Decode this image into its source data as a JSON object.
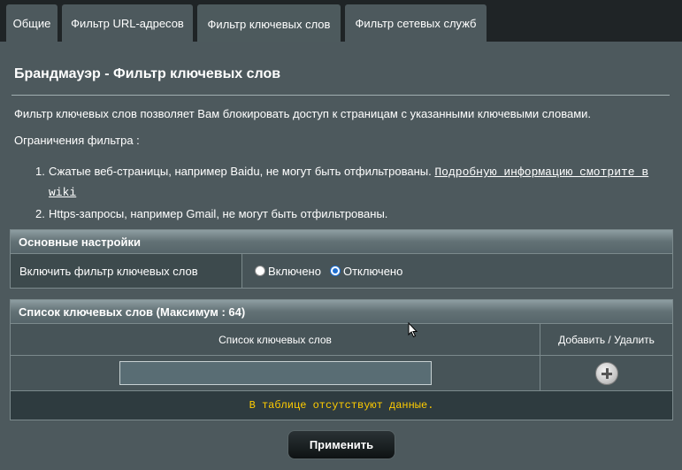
{
  "tabs": [
    {
      "label": "Общие"
    },
    {
      "label": "Фильтр URL-адресов"
    },
    {
      "label": "Фильтр ключевых слов"
    },
    {
      "label": "Фильтр сетевых служб"
    }
  ],
  "page": {
    "title": "Брандмауэр - Фильтр ключевых слов",
    "description": "Фильтр ключевых слов позволяет Вам блокировать доступ к страницам с указанными ключевыми словами.",
    "limits_label": "Ограничения фильтра :",
    "limits": [
      {
        "num": "1.",
        "text": "Сжатые веб-страницы, например Baidu, не могут быть отфильтрованы.",
        "link": "Подробную информацию смотрите в wiki"
      },
      {
        "num": "2.",
        "text": "Https-запросы, например Gmail, не могут быть отфильтрованы."
      }
    ]
  },
  "settings": {
    "header": "Основные настройки",
    "enable_label": "Включить фильтр ключевых слов",
    "options": [
      {
        "label": "Включено",
        "checked": false
      },
      {
        "label": "Отключено",
        "checked": true
      }
    ]
  },
  "keywords": {
    "header": "Список ключевых слов (Максимум : 64)",
    "col_list": "Список ключевых слов",
    "col_action": "Добавить / Удалить",
    "input_value": "",
    "empty_message": "В таблице отсутствуют данные."
  },
  "apply_label": "Применить",
  "colors": {
    "panel_bg": "#4d595d",
    "page_bg": "#1f2426",
    "empty_text": "#ffcc00",
    "radio_checked": "#1f6fd0"
  }
}
